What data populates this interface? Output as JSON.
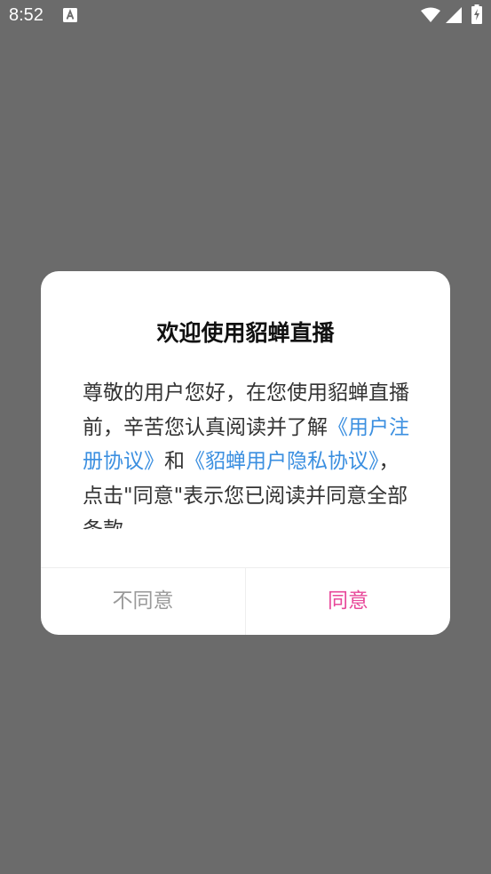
{
  "status_bar": {
    "time": "8:52",
    "notification_icon": "font-a-icon",
    "wifi_icon": "wifi-icon",
    "signal_icon": "cell-signal-icon",
    "battery_icon": "battery-charging-icon"
  },
  "dialog": {
    "title": "欢迎使用貂蝉直播",
    "body_text_1": "尊敬的用户您好，在您使用貂蝉直播前，辛苦您认真阅读并了解",
    "user_agreement_link": "《用户注册协议》",
    "body_text_2": "和",
    "privacy_link": "《貂蝉用户隐私协议》",
    "body_text_3": "，点击\"同意\"表示您已阅读并同意全部条款",
    "disagree_label": "不同意",
    "agree_label": "同意"
  },
  "colors": {
    "overlay": "#6b6b6b",
    "link": "#3b8fe0",
    "agree": "#e8489a",
    "disagree": "#9a9a9a"
  }
}
